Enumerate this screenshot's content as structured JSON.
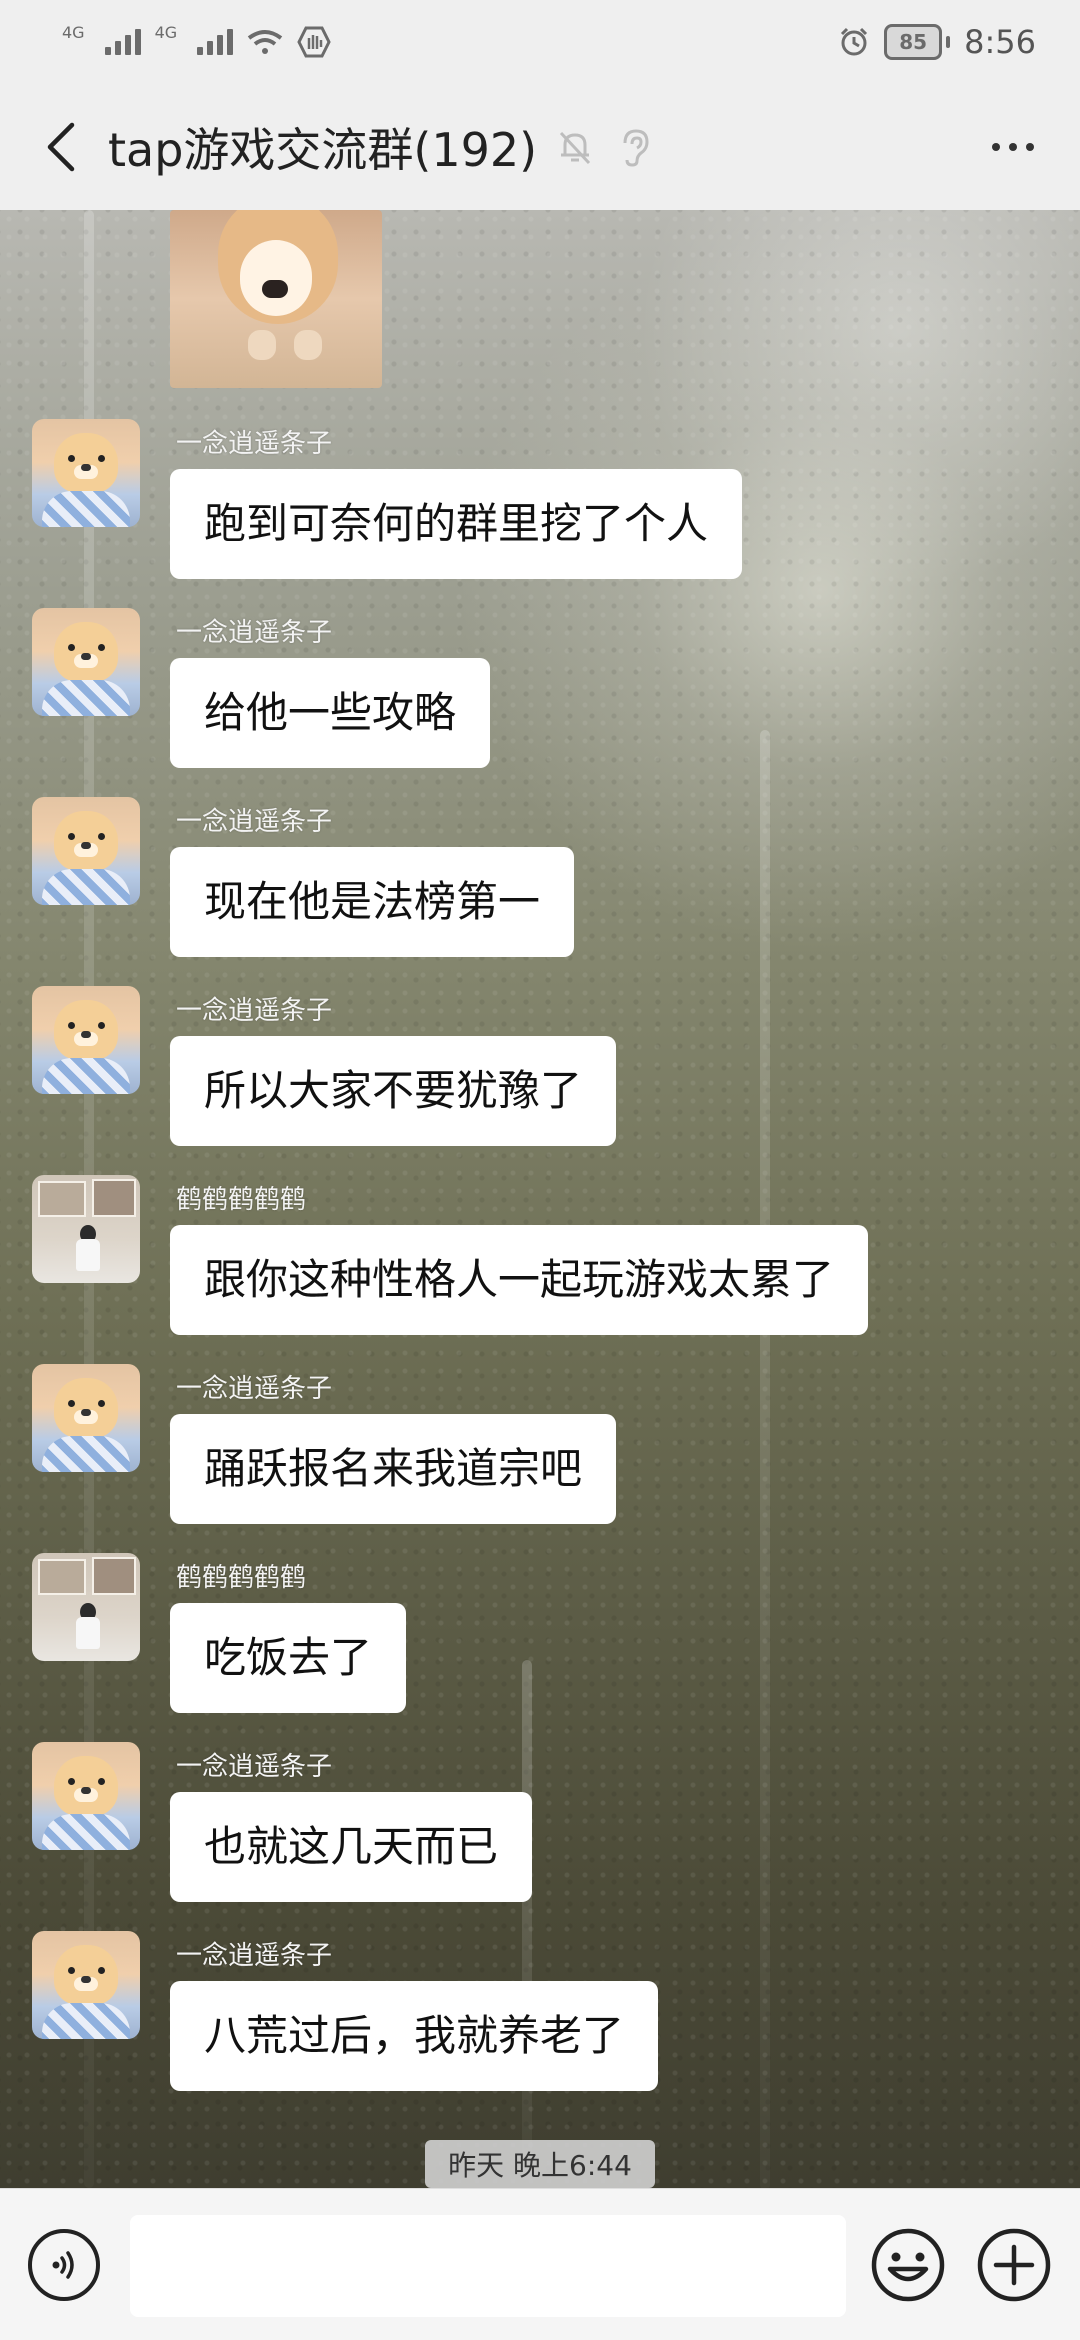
{
  "status_bar": {
    "network_1": "4G",
    "network_2": "4G",
    "battery": "85",
    "time": "8:56"
  },
  "header": {
    "title": "tap游戏交流群(192)"
  },
  "messages": [
    {
      "sender": "一念逍遥条子",
      "text": "跑到可奈何的群里挖了个人"
    },
    {
      "sender": "一念逍遥条子",
      "text": "给他一些攻略"
    },
    {
      "sender": "一念逍遥条子",
      "text": "现在他是法榜第一"
    },
    {
      "sender": "一念逍遥条子",
      "text": "所以大家不要犹豫了"
    },
    {
      "sender": "鹤鹤鹤鹤鹤",
      "text": "跟你这种性格人一起玩游戏太累了"
    },
    {
      "sender": "一念逍遥条子",
      "text": "踊跃报名来我道宗吧"
    },
    {
      "sender": "鹤鹤鹤鹤鹤",
      "text": "吃饭去了"
    },
    {
      "sender": "一念逍遥条子",
      "text": "也就这几天而已"
    },
    {
      "sender": "一念逍遥条子",
      "text": "八荒过后，我就养老了"
    }
  ],
  "timestamp": "昨天 晚上6:44",
  "input": {
    "value": "",
    "placeholder": ""
  }
}
